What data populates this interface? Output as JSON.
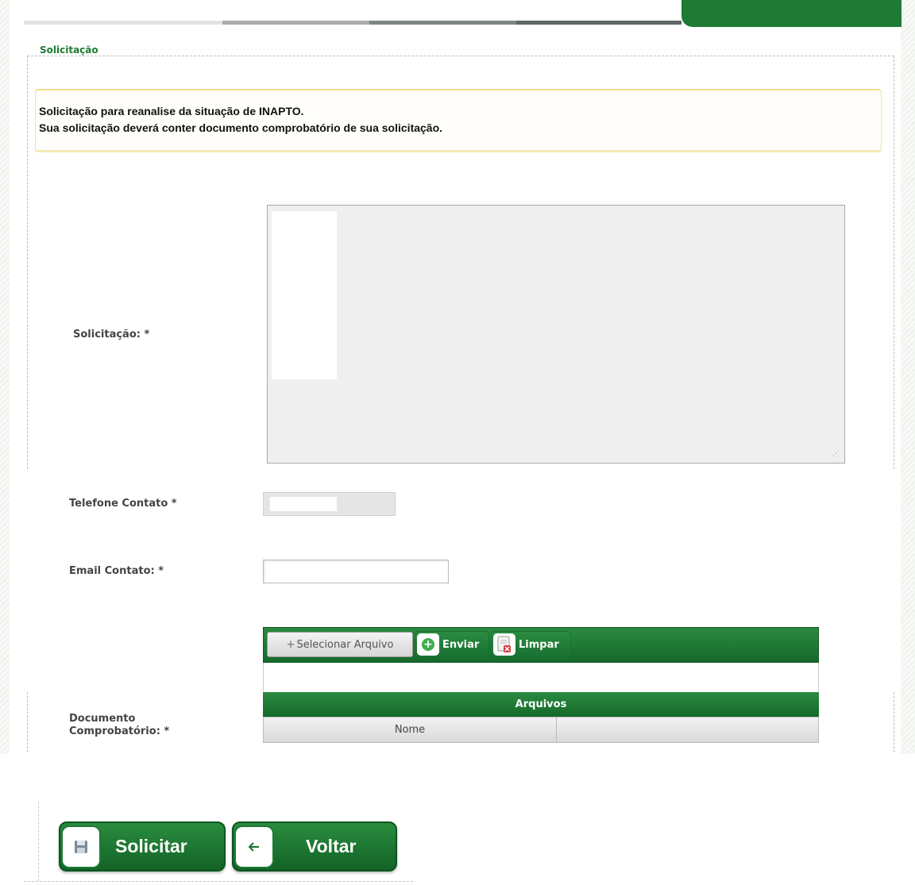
{
  "fieldset": {
    "legend": "Solicitação"
  },
  "notice": {
    "line1": "Solicitação para reanalise da situação de INAPTO.",
    "line2": "Sua solicitação deverá conter documento comprobatório de sua solicitação."
  },
  "form": {
    "solicitacao_label": "Solicitação: *",
    "telefone_label": "Telefone Contato *",
    "email_label": "Email Contato: *",
    "documento_label_1": "Documento",
    "documento_label_2": "Comprobatório: *"
  },
  "upload": {
    "select_label": "Selecionar Arquivo",
    "send_label": "Enviar",
    "clear_label": "Limpar",
    "files_title": "Arquivos",
    "col_name": "Nome"
  },
  "actions": {
    "submit_label": "Solicitar",
    "back_label": "Voltar"
  },
  "colors": {
    "brand_green": "#1e7a34",
    "notice_border": "#f3de8a"
  }
}
